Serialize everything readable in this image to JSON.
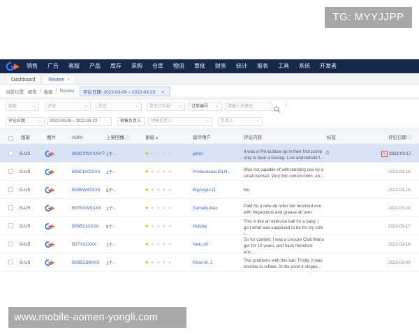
{
  "overlay": {
    "top_badge": "TG: MYYJJPP",
    "bottom_banner": "www.mobile-aomen-yongli.com"
  },
  "nav": {
    "items": [
      "销售",
      "广告",
      "客服",
      "产品",
      "库存",
      "采购",
      "仓库",
      "物流",
      "审批",
      "财务",
      "统计",
      "报表",
      "工具",
      "系统",
      "开发者"
    ]
  },
  "tabs": [
    {
      "label": "Dashboard"
    },
    {
      "label": "Review",
      "close": "×"
    }
  ],
  "breadcrumb": {
    "prefix": "当前位置:",
    "path1": "报告",
    "path2": "客服",
    "path3": "Review",
    "filter": "评论日期: 2022-03-09 ~ 2022-03-23",
    "filter_close": "×"
  },
  "filters": {
    "row1": [
      "国家",
      "评级",
      "状态",
      "是否已匹配",
      "订单编号"
    ],
    "search_placeholder": "请输入关键词",
    "row2_date_type": "评论日期",
    "date_range": "2022-03-09  ~  2022-03-23",
    "row2_sales": "销售负责人",
    "row2_select2": "销售负责人",
    "row2_select3": "负责人"
  },
  "table": {
    "headers": {
      "country": "国家",
      "image": "图片",
      "asin": "ASIN",
      "listing": "上架回播",
      "rating": "星级",
      "reviewer": "留评用户",
      "content": "评论内容",
      "tags": "标签",
      "date": "评论日期"
    },
    "rows": [
      {
        "country": "G-US",
        "asin": "B09CXWXXXX",
        "qty": "1个",
        "stars": 1,
        "reviewer": "jamin",
        "review": "It was a PIA to blow up in their foot pump only to hear a hissing. Low and behold t...",
        "date": "2022-03-17"
      },
      {
        "country": "G-US",
        "asin": "B09CDXDXXX",
        "qty": "1个",
        "stars": 1,
        "reviewer": "Professional Ed R...",
        "review": "Was not capable of withstanding use by a small woman. Very thin construction, an...",
        "date": "2022-03-18"
      },
      {
        "country": "G-US",
        "asin": "B08BWX9XXX",
        "qty": "5个",
        "stars": 1,
        "reviewer": "BigAng1121",
        "review": "No",
        "date": "2022-03-16"
      },
      {
        "country": "G-US",
        "asin": "B07RXWSXXX",
        "qty": "1个",
        "stars": 1,
        "reviewer": "Samally Mao",
        "review": "Paid for a new ab roller but received one with fingerprints and grease all over",
        "date": "2022-03-16"
      },
      {
        "country": "G-US",
        "asin": "B09B21SXXX",
        "qty": "5个",
        "stars": 1,
        "reviewer": "Holiday",
        "review": "This is like an exercise ball for a baby. I go t what was supposed to be for my size j...",
        "date": "2022-03-17"
      },
      {
        "country": "G-US",
        "asin": "B07YX2XXX",
        "qty": "1个",
        "stars": 1,
        "reviewer": "Nick,UK",
        "review": "So for context; I was a Leisure Club Mana ger for 10 years, and have therefore enc...",
        "date": "2022-03-16"
      },
      {
        "country": "G-US",
        "asin": "B09B21MXXX",
        "qty": "1个",
        "stars": 1,
        "reviewer": "Rose M. J.",
        "review": "Two problems with this ball. Firstly, it was horrible to reflate. At the point it stoppe...",
        "date": "2022-03-09"
      }
    ]
  },
  "colors": {
    "nav_bg": "#15274b",
    "link": "#3467d1",
    "star_on": "#e3b600",
    "selected_row": "#d7e3f4"
  }
}
